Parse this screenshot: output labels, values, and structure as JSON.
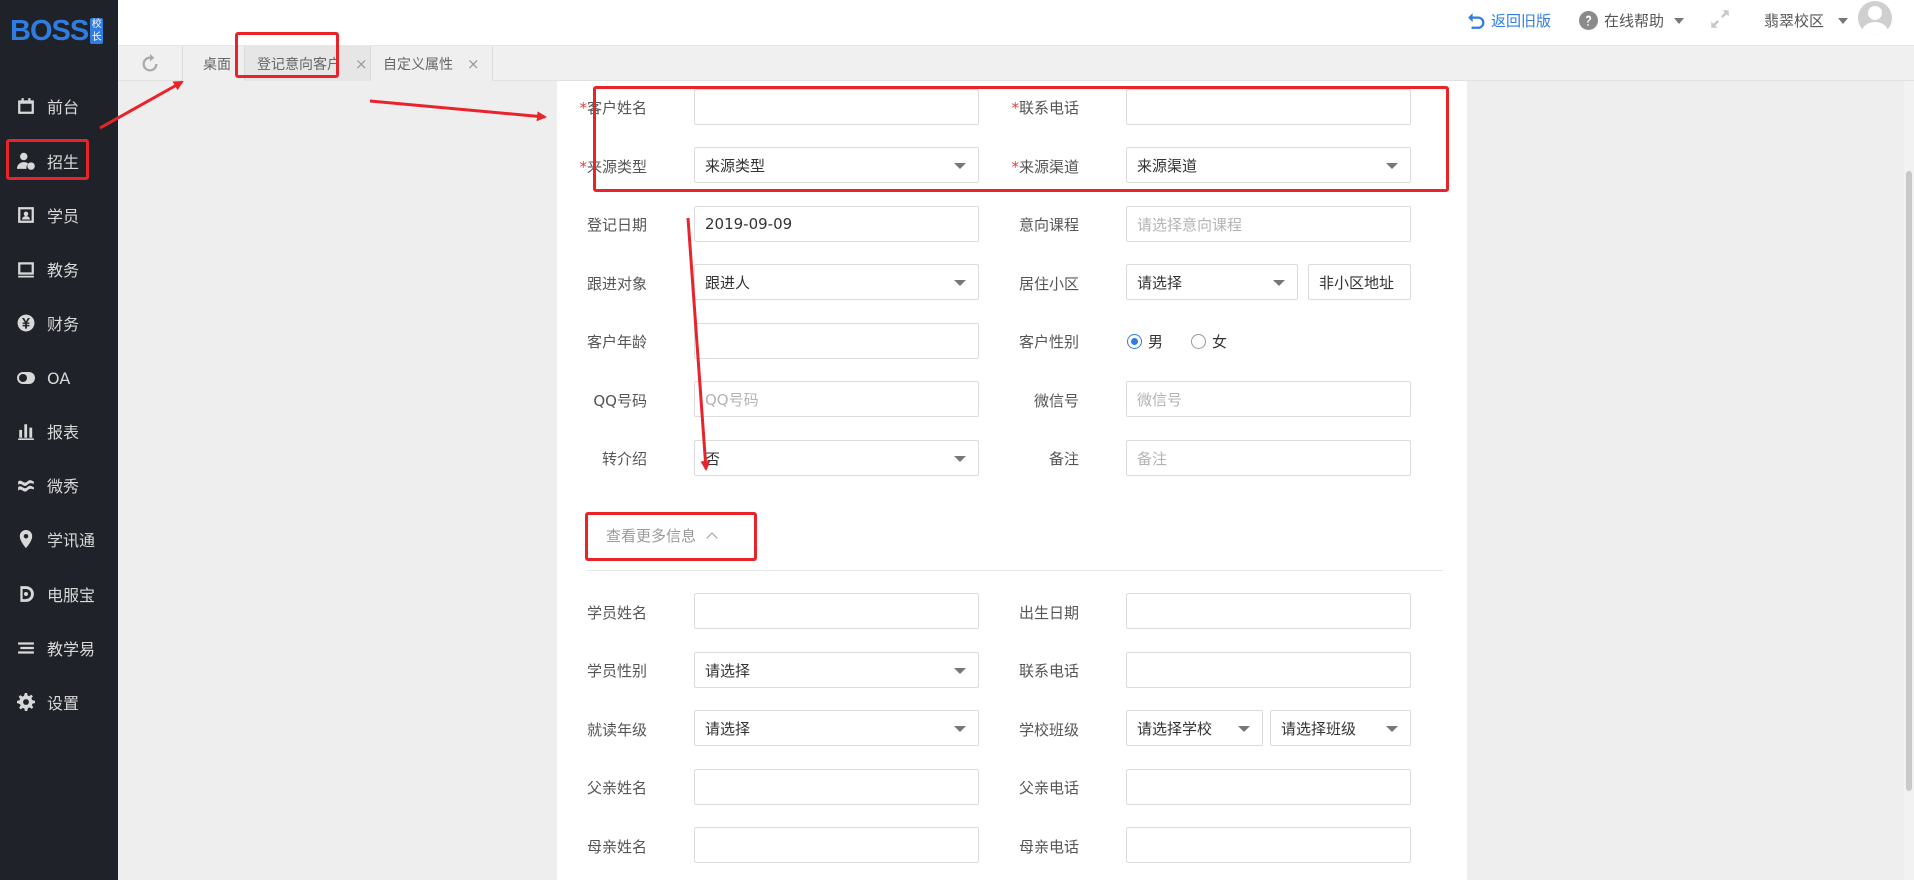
{
  "logo": {
    "text": "BOSS",
    "sub": "校长"
  },
  "sidebar": {
    "items": [
      {
        "label": "前台",
        "icon": "calendar-icon"
      },
      {
        "label": "招生",
        "icon": "user-add-icon"
      },
      {
        "label": "学员",
        "icon": "student-card-icon"
      },
      {
        "label": "教务",
        "icon": "book-icon"
      },
      {
        "label": "财务",
        "icon": "yen-icon"
      },
      {
        "label": "OA",
        "icon": "toggle-icon"
      },
      {
        "label": "报表",
        "icon": "bar-chart-icon"
      },
      {
        "label": "微秀",
        "icon": "wave-icon"
      },
      {
        "label": "学讯通",
        "icon": "location-pin-icon"
      },
      {
        "label": "电服宝",
        "icon": "sound-icon"
      },
      {
        "label": "教学易",
        "icon": "stack-icon"
      },
      {
        "label": "设置",
        "icon": "gear-icon"
      }
    ]
  },
  "header": {
    "back_old": "返回旧版",
    "help": "在线帮助",
    "campus": "翡翠校区"
  },
  "tabs": {
    "desktop": "桌面",
    "items": [
      {
        "label": "登记意向客户",
        "close": "×"
      },
      {
        "label": "自定义属性",
        "close": "×"
      }
    ]
  },
  "form": {
    "customer_name": {
      "label": "客户姓名",
      "value": ""
    },
    "phone": {
      "label": "联系电话",
      "value": ""
    },
    "source_type": {
      "label": "来源类型",
      "value": "来源类型"
    },
    "source_channel": {
      "label": "来源渠道",
      "value": "来源渠道"
    },
    "reg_date": {
      "label": "登记日期",
      "value": "2019-09-09"
    },
    "course": {
      "label": "意向课程",
      "placeholder": "请选择意向课程"
    },
    "follower": {
      "label": "跟进对象",
      "value": "跟进人"
    },
    "community": {
      "label": "居住小区",
      "value": "请选择",
      "extra": "非小区地址"
    },
    "age": {
      "label": "客户年龄",
      "value": ""
    },
    "gender": {
      "label": "客户性别",
      "male": "男",
      "female": "女",
      "selected": "男"
    },
    "qq": {
      "label": "QQ号码",
      "placeholder": "QQ号码"
    },
    "wechat": {
      "label": "微信号",
      "placeholder": "微信号"
    },
    "referral": {
      "label": "转介绍",
      "value": "否"
    },
    "remark": {
      "label": "备注",
      "placeholder": "备注"
    },
    "more_info": "查看更多信息",
    "student_name": {
      "label": "学员姓名",
      "value": ""
    },
    "birthday": {
      "label": "出生日期",
      "value": ""
    },
    "student_gender": {
      "label": "学员性别",
      "value": "请选择"
    },
    "student_phone": {
      "label": "联系电话",
      "value": ""
    },
    "grade": {
      "label": "就读年级",
      "value": "请选择"
    },
    "school_class": {
      "label": "学校班级",
      "school": "请选择学校",
      "class": "请选择班级"
    },
    "father_name": {
      "label": "父亲姓名",
      "value": ""
    },
    "father_phone": {
      "label": "父亲电话",
      "value": ""
    },
    "mother_name": {
      "label": "母亲姓名",
      "value": ""
    },
    "mother_phone": {
      "label": "母亲电话",
      "value": ""
    },
    "required_mark": "*"
  },
  "colors": {
    "sidebar": "#1f2329",
    "accent": "#2f7de0",
    "annotation": "#e8232a"
  }
}
